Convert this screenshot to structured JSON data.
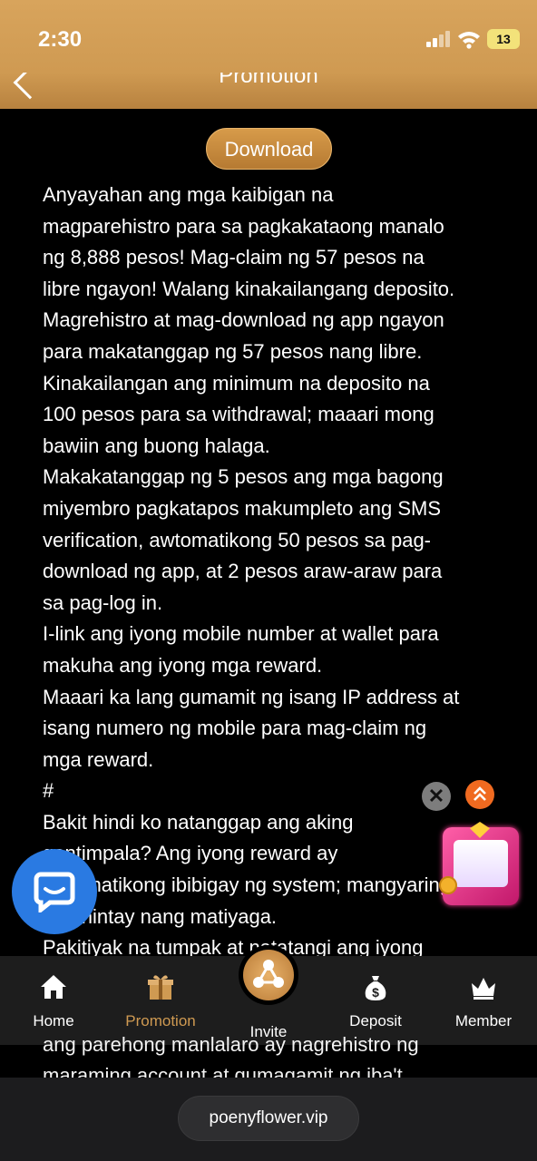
{
  "status_bar": {
    "time": "2:30",
    "battery": "13"
  },
  "header": {
    "title": "Promotion"
  },
  "download_button": "Download",
  "promo_text": "Anyayahan ang mga kaibigan na\nmagparehistro para sa pagkakataong manalo\nng 8,888 pesos! Mag-claim ng 57 pesos na\nlibre ngayon! Walang kinakailangang deposito.\nMagrehistro at mag-download ng app ngayon\npara makatanggap ng 57 pesos nang libre.\nKinakailangan ang minimum na deposito na\n100 pesos para sa withdrawal; maaari mong\nbawiin ang buong halaga.\nMakakatanggap ng 5 pesos ang mga bagong\nmiyembro pagkatapos makumpleto ang SMS\nverification, awtomatikong 50 pesos sa pag-\ndownload ng app, at 2 pesos araw-araw para\nsa pag-log in.\nI-link ang iyong mobile number at wallet para\nmakuha ang iyong mga reward.\nMaaari ka lang gumamit ng isang IP address at\nisang numero ng mobile para mag-claim ng\nmga reward.\n#\nBakit hindi ko natanggap ang aking\ngantimpala? Ang iyong reward ay\nawtomatikong ibibigay ng system; mangyaring\nmaghintay nang matiyaga.\nPakitiyak na tumpak at natatangi ang iyong",
  "overflow_text": "ang parehong manlalaro ay nagrehistro ng\nmaraming account at gumagamit ng iba't",
  "float_close": "✕",
  "nav": [
    {
      "label": "Home",
      "icon": "home-icon"
    },
    {
      "label": "Promotion",
      "icon": "gift-icon"
    },
    {
      "label": "Invite",
      "icon": "invite-icon"
    },
    {
      "label": "Deposit",
      "icon": "money-bag-icon"
    },
    {
      "label": "Member",
      "icon": "crown-icon"
    }
  ],
  "browser": {
    "url": "poenyflower.vip"
  },
  "colors": {
    "accent": "#cf9a52",
    "chat": "#2a7ae2",
    "scroll_top": "#f06a20"
  }
}
